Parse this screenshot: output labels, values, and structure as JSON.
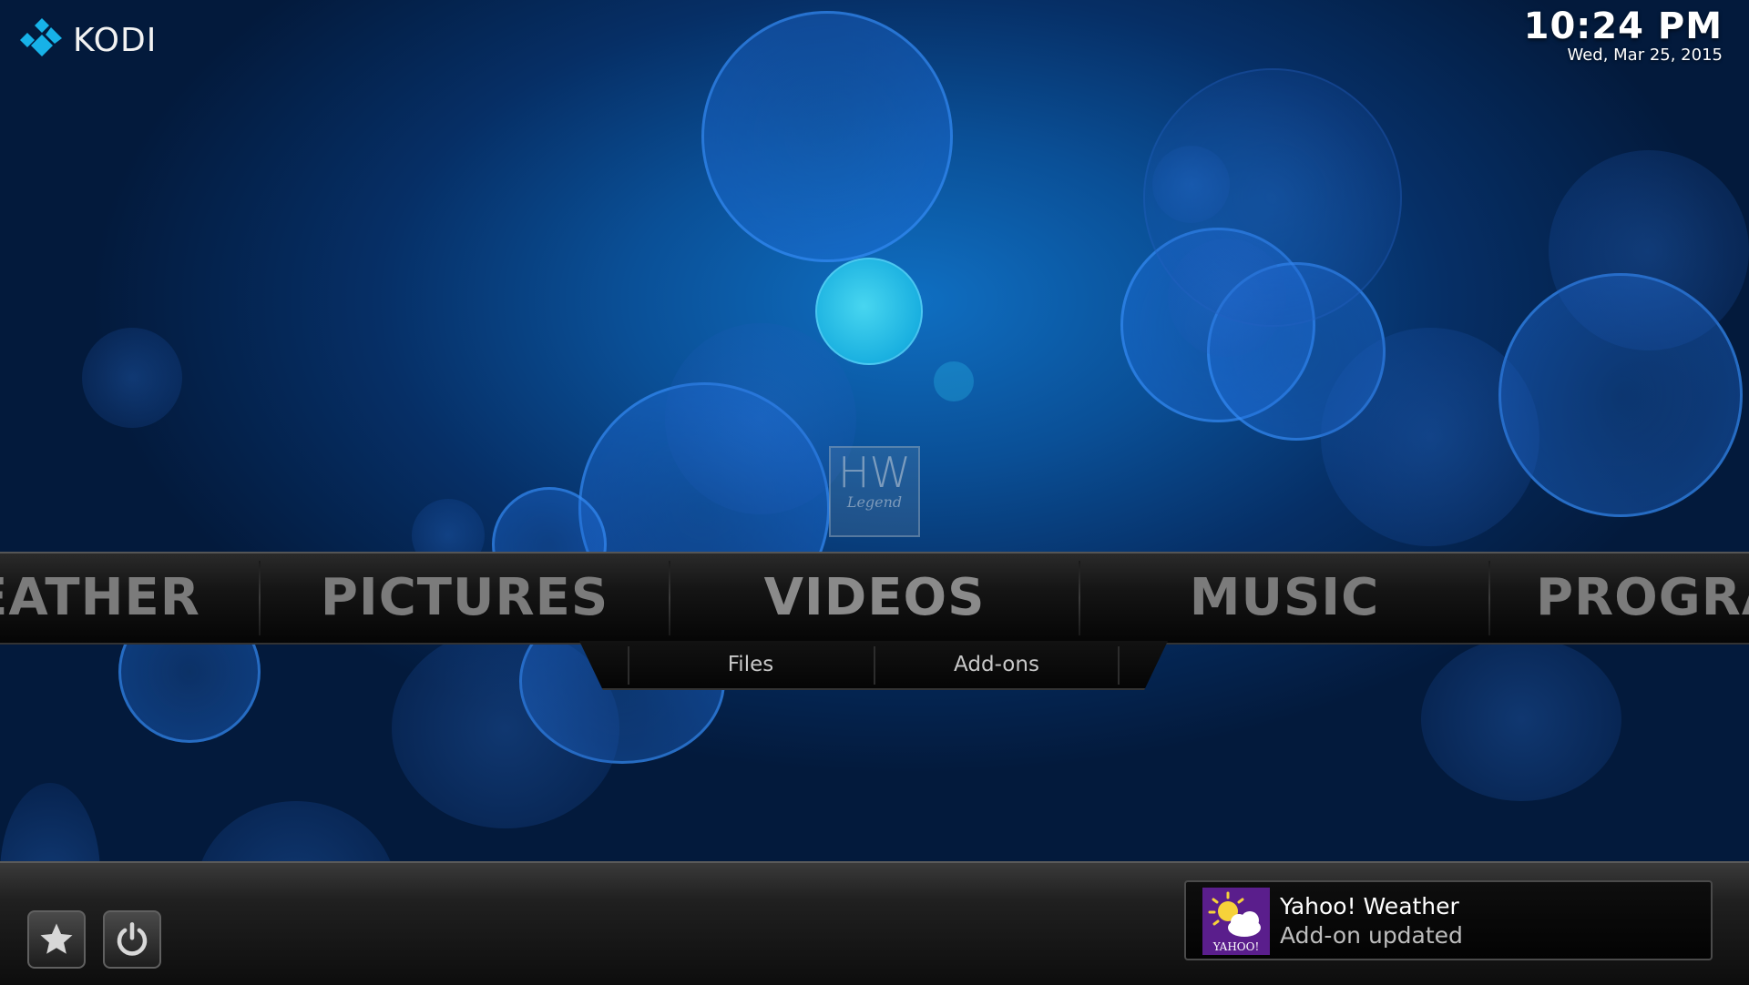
{
  "header": {
    "logo_text": "KODI",
    "time": "10:24 PM",
    "date": "Wed, Mar 25, 2015"
  },
  "watermark": {
    "top": "HW",
    "bottom": "Legend"
  },
  "main_menu": {
    "items": [
      "EATHER",
      "PICTURES",
      "VIDEOS",
      "MUSIC",
      "PROGRA"
    ],
    "selected": "VIDEOS"
  },
  "submenu": {
    "items": [
      "Files",
      "Add-ons"
    ]
  },
  "bottom": {
    "favourites_icon": "star-icon",
    "power_icon": "power-icon"
  },
  "notification": {
    "title": "Yahoo! Weather",
    "message": "Add-on updated",
    "icon_label": "YAHOO!",
    "icon_color": "#5a1e8c"
  },
  "colors": {
    "accent": "#12a0e0",
    "background": "#041a3a"
  }
}
